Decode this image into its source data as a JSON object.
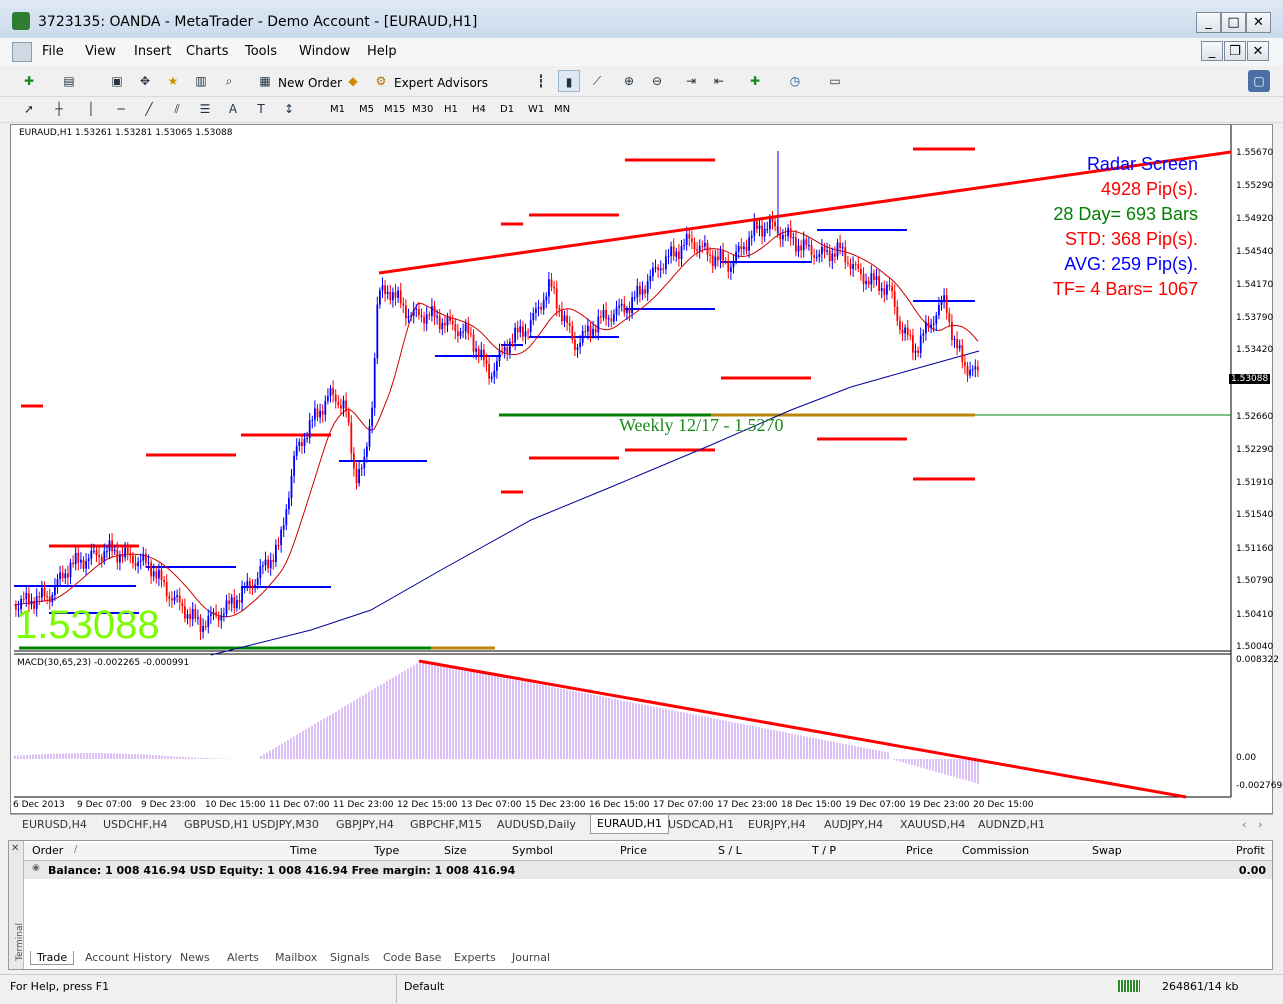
{
  "window": {
    "title": "3723135: OANDA - MetaTrader - Demo Account - [EURAUD,H1]"
  },
  "menu": [
    "File",
    "View",
    "Insert",
    "Charts",
    "Tools",
    "Window",
    "Help"
  ],
  "toolbar": {
    "new_order": "New Order",
    "expert_advisors": "Expert Advisors"
  },
  "timeframes": [
    "M1",
    "M5",
    "M15",
    "M30",
    "H1",
    "H4",
    "D1",
    "W1",
    "MN"
  ],
  "chart": {
    "header": "EURAUD,H1  1.53261 1.53281 1.53065 1.53088",
    "big_price": "1.53088",
    "price_tag": "1.53088",
    "price_axis": [
      "1.55670",
      "1.55290",
      "1.54920",
      "1.54540",
      "1.54170",
      "1.53790",
      "1.53420",
      "1.53088",
      "1.52660",
      "1.52290",
      "1.51910",
      "1.51540",
      "1.51160",
      "1.50790",
      "1.50410",
      "1.50040"
    ],
    "weekly_label": "Weekly 12/17 - 1.5270",
    "radar": {
      "title": "Radar Screen",
      "pips": "4928 Pip(s).",
      "day": "28 Day= 693 Bars",
      "std": "STD: 368 Pip(s).",
      "avg": "AVG: 259 Pip(s).",
      "tf": "TF= 4 Bars= 1067"
    },
    "macd_header": "MACD(30,65,23) -0.002265 -0.000991",
    "macd_axis": [
      "0.008322",
      "0.00",
      "-0.002769"
    ],
    "time_axis": [
      "6 Dec 2013",
      "9 Dec 07:00",
      "9 Dec 23:00",
      "10 Dec 15:00",
      "11 Dec 07:00",
      "11 Dec 23:00",
      "12 Dec 15:00",
      "13 Dec 07:00",
      "15 Dec 23:00",
      "16 Dec 15:00",
      "17 Dec 07:00",
      "17 Dec 23:00",
      "18 Dec 15:00",
      "19 Dec 07:00",
      "19 Dec 23:00",
      "20 Dec 15:00"
    ],
    "colors": {
      "red": "#ff0000",
      "blue": "#0000ff",
      "green": "#008000",
      "lime": "#7cfc00",
      "bull": "#0000ff",
      "bear": "#ff0000"
    }
  },
  "chart_tabs": [
    "EURUSD,H4",
    "USDCHF,H4",
    "GBPUSD,H1",
    "USDJPY,M30",
    "GBPJPY,H4",
    "GBPCHF,M15",
    "AUDUSD,Daily",
    "EURAUD,H1",
    "USDCAD,H1",
    "EURJPY,H4",
    "AUDJPY,H4",
    "XAUUSD,H4",
    "AUDNZD,H1"
  ],
  "terminal": {
    "columns": [
      "Order",
      "Time",
      "Type",
      "Size",
      "Symbol",
      "Price",
      "S / L",
      "T / P",
      "Price",
      "Commission",
      "Swap",
      "Profit"
    ],
    "balance_line": "Balance: 1 008 416.94 USD  Equity: 1 008 416.94  Free margin: 1 008 416.94",
    "profit": "0.00",
    "side_label": "Terminal",
    "tabs": [
      "Trade",
      "Account History",
      "News",
      "Alerts",
      "Mailbox",
      "Signals",
      "Code Base",
      "Experts",
      "Journal"
    ]
  },
  "status": {
    "help": "For Help, press F1",
    "profile": "Default",
    "traffic": "264861/14 kb"
  }
}
